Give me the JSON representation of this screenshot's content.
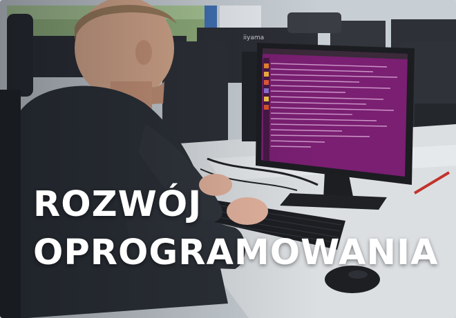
{
  "caption": {
    "line1": "ROZWÓJ",
    "line2": "OPROGRAMOWANIA"
  },
  "monitor": {
    "brand": "iiyama",
    "terminal_color": "#7a1f72"
  },
  "colors": {
    "caption_text": "#ffffff",
    "sweater": "#2b2f36",
    "desk": "#dcdfe2"
  }
}
